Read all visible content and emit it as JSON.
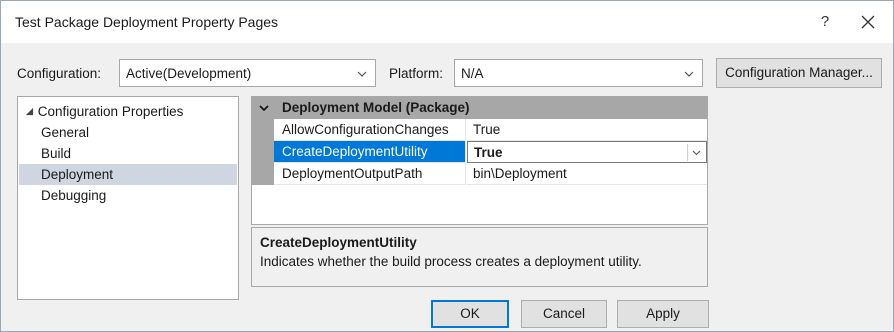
{
  "window": {
    "title": "Test Package Deployment Property Pages",
    "help_label": "?",
    "close_icon": "close-icon"
  },
  "toolbar": {
    "configuration_label": "Configuration:",
    "configuration_value": "Active(Development)",
    "platform_label": "Platform:",
    "platform_value": "N/A",
    "config_manager_label": "Configuration Manager..."
  },
  "tree": {
    "root_label": "Configuration Properties",
    "items": [
      {
        "label": "General"
      },
      {
        "label": "Build"
      },
      {
        "label": "Deployment"
      },
      {
        "label": "Debugging"
      }
    ],
    "selected": "Deployment"
  },
  "grid": {
    "category": "Deployment Model (Package)",
    "rows": [
      {
        "name": "AllowConfigurationChanges",
        "value": "True"
      },
      {
        "name": "CreateDeploymentUtility",
        "value": "True"
      },
      {
        "name": "DeploymentOutputPath",
        "value": "bin\\Deployment"
      }
    ],
    "selected_property": "CreateDeploymentUtility"
  },
  "description": {
    "title": "CreateDeploymentUtility",
    "text": "Indicates whether the build process creates a deployment utility."
  },
  "buttons": {
    "ok": "OK",
    "cancel": "Cancel",
    "apply": "Apply"
  },
  "colors": {
    "selection": "#0078d7",
    "tree_selection": "#cfd6e1",
    "category_band": "#a7a7a7"
  }
}
